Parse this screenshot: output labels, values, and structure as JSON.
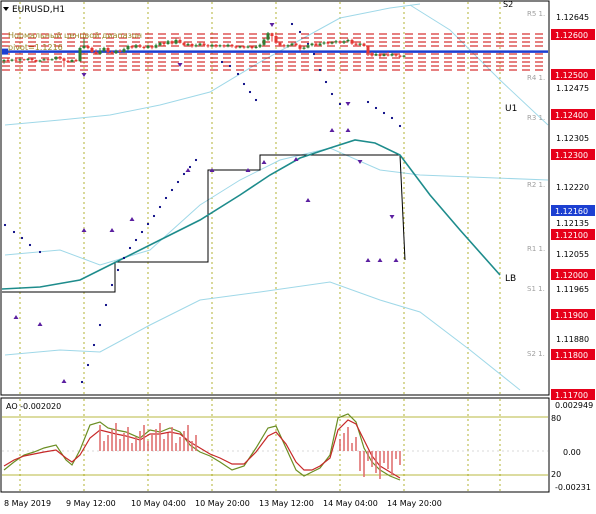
{
  "window": {
    "title": "EURUSD,H1",
    "subtitle": "Нормальный ценовой диапазон",
    "pivot_text": "pivot=1.1216",
    "corner_label": "S2"
  },
  "colors": {
    "background": "#ffffff",
    "frame": "#000000",
    "grid": "#a0a000",
    "bull": "#2e7d32",
    "bear": "#e53935",
    "level_line": "#cc0000",
    "level_badge": "#e6001a",
    "pivot_line": "#1c3fd1",
    "ma": "#1e8c8c",
    "band": "#9fd8e8",
    "step": "#000000",
    "sar": "#000080",
    "arrow": "#5b1fa0",
    "label_text": "#a0a0a0",
    "osc_green": "#6b8e23",
    "osc_red": "#c62828",
    "osc_bar": "#e07070"
  },
  "price_axis": {
    "ticks": [
      "1.12645",
      "1.12475",
      "1.12305",
      "1.12220",
      "1.12135",
      "1.12055",
      "1.11965",
      "1.11880"
    ],
    "badges": [
      {
        "label": "1.12600",
        "value": 1.126
      },
      {
        "label": "1.12500",
        "value": 1.125
      },
      {
        "label": "1.12400",
        "value": 1.124
      },
      {
        "label": "1.12300",
        "value": 1.123
      },
      {
        "label": "1.12160",
        "value": 1.1216
      },
      {
        "label": "1.12100",
        "value": 1.121
      },
      {
        "label": "1.12000",
        "value": 1.12
      },
      {
        "label": "1.11900",
        "value": 1.119
      },
      {
        "label": "1.11800",
        "value": 1.118
      },
      {
        "label": "1.11700",
        "value": 1.117
      }
    ]
  },
  "pivot_labels": [
    "R5 1.",
    "R4 1.",
    "R3 1.",
    "R2 1.",
    "R1 1.",
    "S1 1.",
    "S2 1."
  ],
  "annotations": {
    "u1": "U1",
    "lb": "LB"
  },
  "oscillator": {
    "label": "AO -0.002020",
    "ticks": [
      "0.002949",
      "80",
      "0.00",
      "20",
      "-0.00231"
    ]
  },
  "time_axis": [
    "8 May 2019",
    "9 May 12:00",
    "10 May 04:00",
    "10 May 20:00",
    "13 May 12:00",
    "14 May 04:00",
    "14 May 20:00"
  ]
}
